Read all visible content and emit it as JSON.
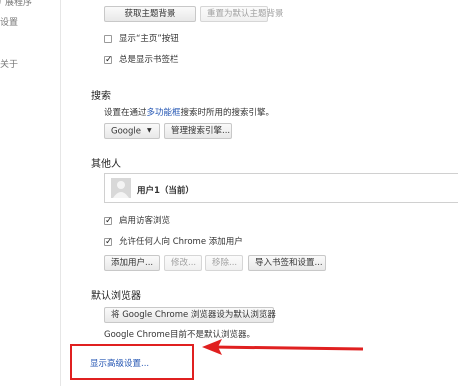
{
  "sidebar": {
    "items": [
      "扩展程序",
      "设置",
      "关于"
    ]
  },
  "appearance": {
    "get_theme_button": "获取主题背景",
    "reset_theme_button": "重置为默认主题背景",
    "show_home_checkbox": "显示“主页”按钮",
    "show_home_checked": false,
    "show_bookmarks_checkbox": "总是显示书签栏",
    "show_bookmarks_checked": true
  },
  "search": {
    "title": "搜索",
    "desc_before": "设置在通过",
    "desc_link": "多功能框",
    "desc_after": "搜索时所用的搜索引擎。",
    "engine_select": "Google",
    "manage_button": "管理搜索引擎..."
  },
  "people": {
    "title": "其他人",
    "user_name": "用户1（当前）",
    "guest_checkbox": "启用访客浏览",
    "guest_checked": true,
    "allow_add_checkbox": "允许任何人向 Chrome 添加用户",
    "allow_add_checked": true,
    "add_user_button": "添加用户...",
    "edit_button": "修改...",
    "remove_button": "移除...",
    "import_button": "导入书签和设置..."
  },
  "default_browser": {
    "title": "默认浏览器",
    "set_default_button": "将 Google Chrome 浏览器设为默认浏览器",
    "status_text": "Google Chrome目前不是默认浏览器。"
  },
  "advanced": {
    "link": "显示高级设置..."
  },
  "colors": {
    "annotation_red": "#e02020",
    "link_blue": "#2456b3"
  }
}
